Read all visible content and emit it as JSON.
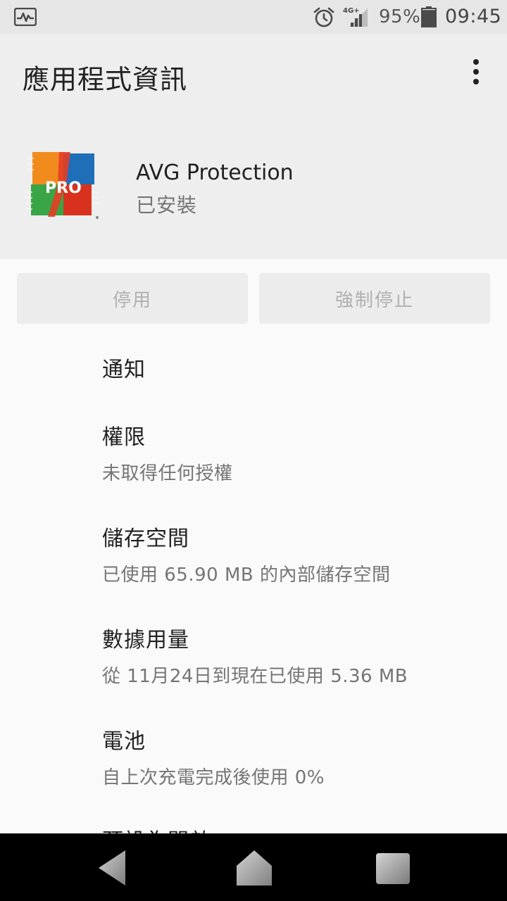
{
  "status_bar": {
    "network": "4G+",
    "battery_percent": "95%",
    "battery_level": 0.95,
    "time": "09:45"
  },
  "app_bar": {
    "title": "應用程式資訊",
    "overflow_icon": "more-vert-icon"
  },
  "app": {
    "icon_label": "PRO",
    "name": "AVG Protection",
    "status": "已安裝"
  },
  "buttons": {
    "disable": "停用",
    "force_stop": "強制停止"
  },
  "settings": [
    {
      "title": "通知",
      "subtitle": ""
    },
    {
      "title": "權限",
      "subtitle": "未取得任何授權"
    },
    {
      "title": "儲存空間",
      "subtitle": "已使用 65.90 MB 的內部儲存空間"
    },
    {
      "title": "數據用量",
      "subtitle": "從 11月24日到現在已使用 5.36 MB"
    },
    {
      "title": "電池",
      "subtitle": "自上次充電完成後使用 0%"
    },
    {
      "title": "預設為開啟",
      "subtitle": ""
    }
  ],
  "colors": {
    "status_bar_bg": "#e6e6e6",
    "app_bar_bg": "#eeeeee",
    "content_bg": "#fafafa",
    "nav_bar_bg": "#000000"
  }
}
